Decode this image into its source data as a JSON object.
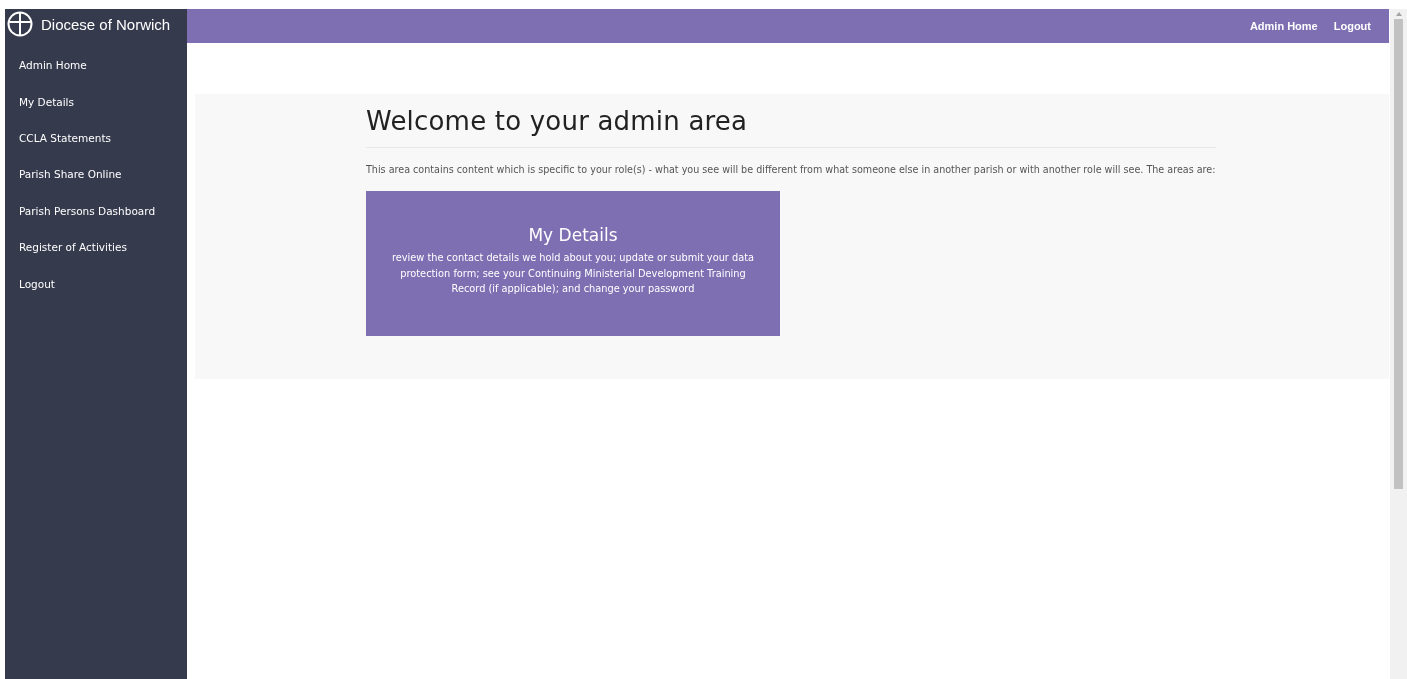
{
  "brand": {
    "title": "Diocese of Norwich"
  },
  "top_nav": [
    {
      "label": "Admin Home"
    },
    {
      "label": "Logout"
    }
  ],
  "sidebar": {
    "items": [
      {
        "label": "Admin Home"
      },
      {
        "label": "My Details"
      },
      {
        "label": "CCLA Statements"
      },
      {
        "label": "Parish Share Online"
      },
      {
        "label": "Parish Persons Dashboard"
      },
      {
        "label": "Register of Activities"
      },
      {
        "label": "Logout"
      }
    ]
  },
  "main": {
    "heading": "Welcome to your admin area",
    "intro": "This area contains content which is specific to your role(s) - what you see will be different from what someone else in another parish or with another role will see. The areas are:",
    "cards": [
      {
        "title": "My Details",
        "description": "review the contact details we hold about you; update or submit your data protection form; see your Continuing Ministerial Development Training Record (if applicable); and change your password"
      }
    ]
  }
}
